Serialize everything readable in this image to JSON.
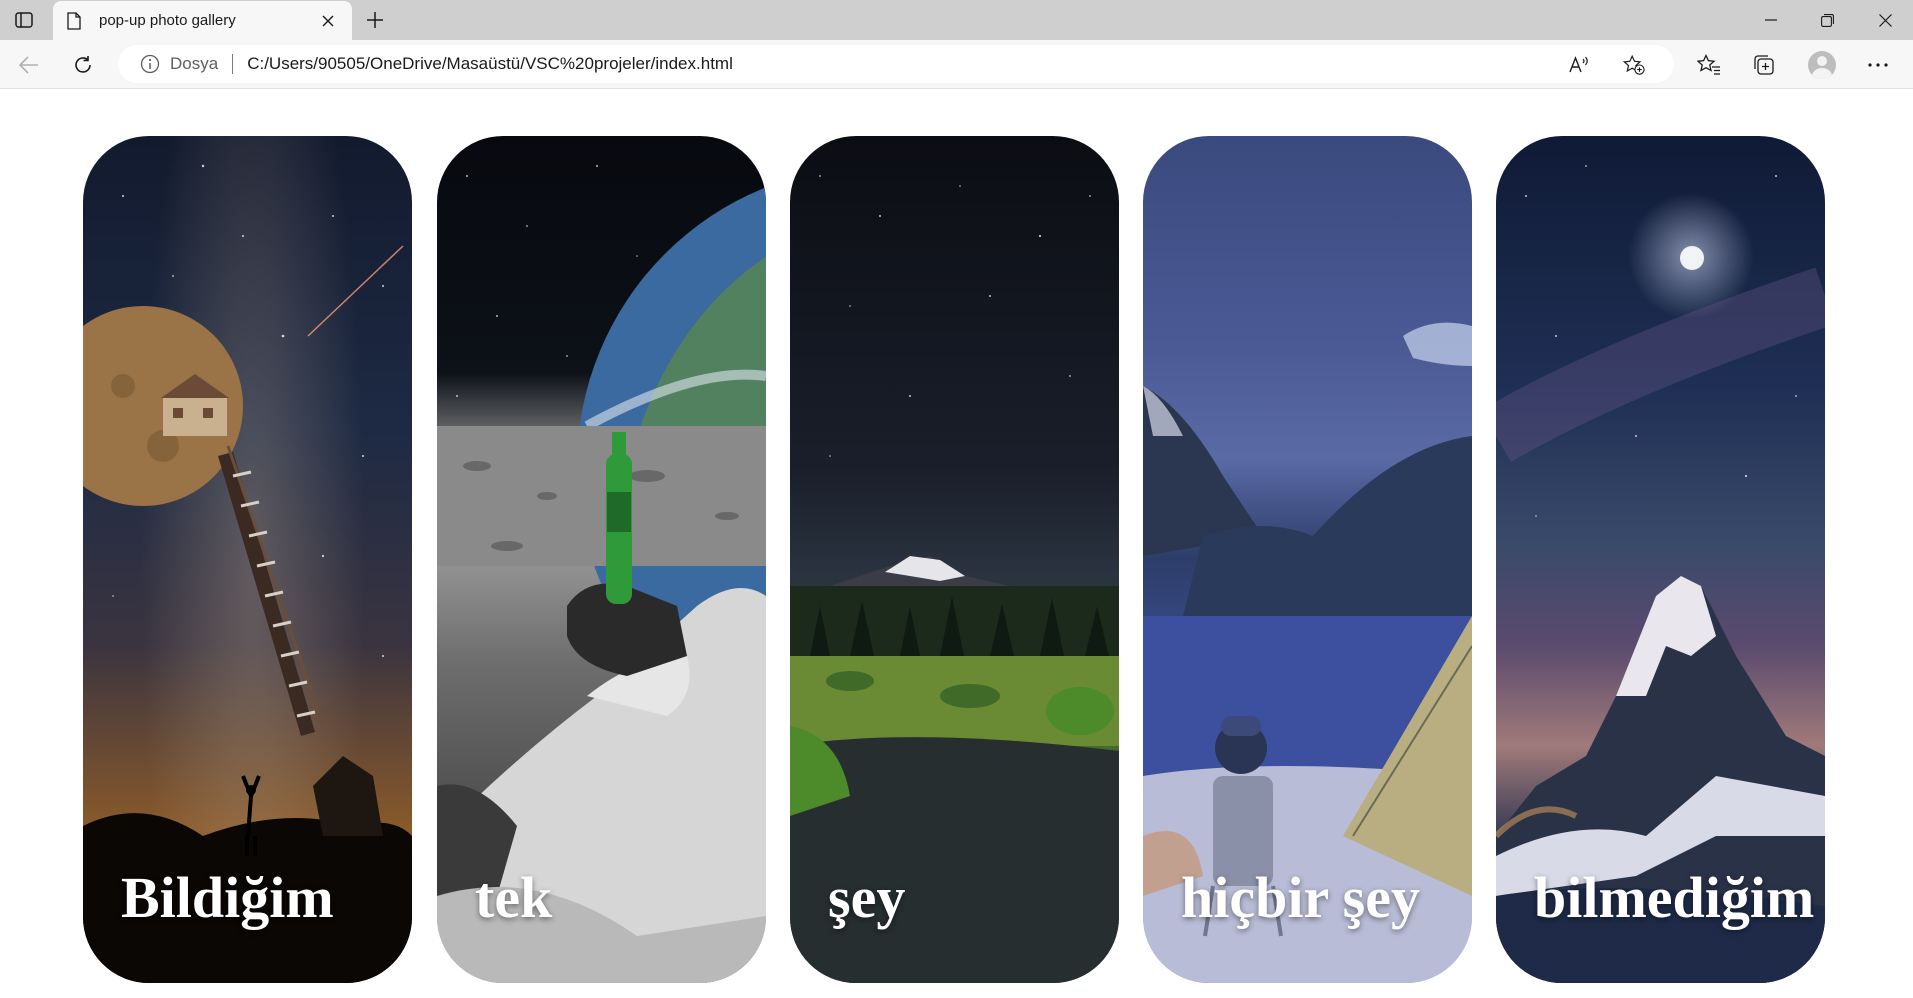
{
  "browser": {
    "tab": {
      "title": "pop-up photo gallery"
    },
    "address": {
      "site_label": "Dosya",
      "url": "C:/Users/90505/OneDrive/Masaüstü/VSC%20projeler/index.html"
    },
    "icons": {
      "tab_actions": "tab-actions-icon",
      "page": "page-icon",
      "close": "close-icon",
      "new_tab": "plus-icon",
      "minimize": "minimize-icon",
      "restore": "restore-icon",
      "window_close": "window-close-icon",
      "back": "back-arrow-icon",
      "reload": "reload-icon",
      "info": "info-icon",
      "read_aloud": "read-aloud-icon",
      "add_favorite": "star-plus-icon",
      "favorites": "favorites-icon",
      "collections": "collections-icon",
      "profile": "profile-avatar",
      "more": "more-icon"
    }
  },
  "gallery": {
    "cards": [
      {
        "caption": "Bildiğim",
        "image": "night sky ladder to moon house"
      },
      {
        "caption": "tek",
        "image": "astronaut holding bottle on moon"
      },
      {
        "caption": "şey",
        "image": "mountain meadow under starry sky"
      },
      {
        "caption": "hiçbir şey",
        "image": "anime camper by lake at night"
      },
      {
        "caption": "bilmediğim",
        "image": "snowy peak under milky way"
      }
    ]
  }
}
